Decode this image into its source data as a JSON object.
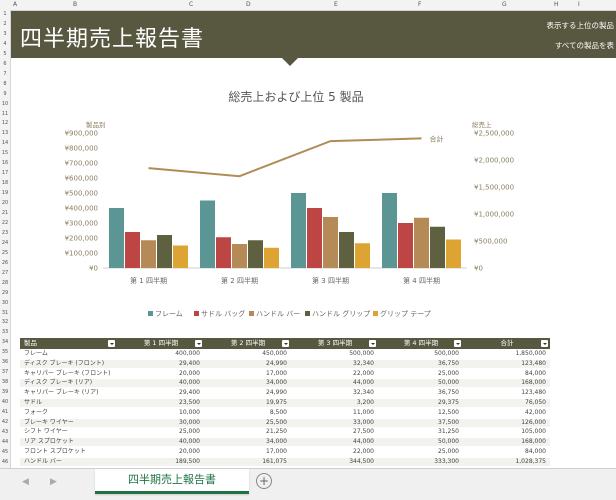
{
  "columns": [
    "A",
    "B",
    "C",
    "D",
    "E",
    "F",
    "G",
    "H",
    "I"
  ],
  "rows": [
    "1",
    "2",
    "3",
    "4",
    "5",
    "6",
    "7",
    "8",
    "9",
    "10",
    "11",
    "12",
    "13",
    "14",
    "15",
    "16",
    "17",
    "18",
    "19",
    "20",
    "21",
    "22",
    "23",
    "24",
    "25",
    "26",
    "27",
    "28",
    "29",
    "30",
    "31",
    "32",
    "33",
    "34",
    "35",
    "36",
    "37",
    "38",
    "39",
    "40",
    "41",
    "42",
    "43",
    "44",
    "45",
    "46"
  ],
  "banner": {
    "title": "四半期売上報告書",
    "right_line1": "表示する上位の製品",
    "right_line2": "すべての製品を表"
  },
  "chart_data": {
    "type": "bar",
    "title": "総売上および上位  5 製品",
    "ylabel": "製品別",
    "y2label": "総売上",
    "categories": [
      "第 1 四半期",
      "第 2 四半期",
      "第 3 四半期",
      "第 4 四半期"
    ],
    "ylim": [
      0,
      900000
    ],
    "y2lim": [
      0,
      2500000
    ],
    "yticks": [
      "¥0",
      "¥100,000",
      "¥200,000",
      "¥300,000",
      "¥400,000",
      "¥500,000",
      "¥600,000",
      "¥700,000",
      "¥800,000",
      "¥900,000"
    ],
    "y2ticks": [
      "¥0",
      "¥500,000",
      "¥1,000,000",
      "¥1,500,000",
      "¥2,000,000",
      "¥2,500,000"
    ],
    "series": [
      {
        "name": "フレーム",
        "color": "#5b9594",
        "values": [
          400000,
          450000,
          500000,
          500000
        ]
      },
      {
        "name": "サドル バッグ",
        "color": "#bd4543",
        "values": [
          240000,
          205000,
          400000,
          300000
        ]
      },
      {
        "name": "ハンドル バー",
        "color": "#b58a57",
        "values": [
          185000,
          160000,
          340000,
          335000
        ]
      },
      {
        "name": "ハンドル グリップ",
        "color": "#5f603f",
        "values": [
          220000,
          185000,
          240000,
          275000
        ]
      },
      {
        "name": "グリップ テープ",
        "color": "#dea433",
        "values": [
          150000,
          135000,
          165000,
          190000
        ]
      }
    ],
    "line": {
      "name": "合計",
      "color": "#b08d57",
      "values": [
        1850000,
        1700000,
        2350000,
        2400000
      ]
    },
    "legend_position": "bottom"
  },
  "table": {
    "headers": [
      "製品",
      "第 1 四半期",
      "第 2 四半期",
      "第 3 四半期",
      "第 4 四半期",
      "合計"
    ],
    "rows": [
      [
        "フレーム",
        "400,000",
        "450,000",
        "500,000",
        "500,000",
        "1,850,000"
      ],
      [
        "ディスク ブレーキ (フロント)",
        "29,400",
        "24,990",
        "32,340",
        "36,750",
        "123,480"
      ],
      [
        "キャリパー ブレーキ (フロント)",
        "20,000",
        "17,000",
        "22,000",
        "25,000",
        "84,000"
      ],
      [
        "ディスク ブレーキ (リア)",
        "40,000",
        "34,000",
        "44,000",
        "50,000",
        "168,000"
      ],
      [
        "キャリパー ブレーキ (リア)",
        "29,400",
        "24,990",
        "32,340",
        "36,750",
        "123,480"
      ],
      [
        "サドル",
        "23,500",
        "19,975",
        "3,200",
        "29,375",
        "76,050"
      ],
      [
        "フォーク",
        "10,000",
        "8,500",
        "11,000",
        "12,500",
        "42,000"
      ],
      [
        "ブレーキ ワイヤー",
        "30,000",
        "25,500",
        "33,000",
        "37,500",
        "126,000"
      ],
      [
        "シフト ワイヤー",
        "25,000",
        "21,250",
        "27,500",
        "31,250",
        "105,000"
      ],
      [
        "リア スプロケット",
        "40,000",
        "34,000",
        "44,000",
        "50,000",
        "168,000"
      ],
      [
        "フロント スプロケット",
        "20,000",
        "17,000",
        "22,000",
        "25,000",
        "84,000"
      ],
      [
        "ハンドル バー",
        "189,500",
        "161,075",
        "344,500",
        "333,300",
        "1,028,375"
      ]
    ]
  },
  "sheet": {
    "tab_label": "四半期売上報告書",
    "prev": "◀",
    "next": "▶",
    "add": "+"
  }
}
